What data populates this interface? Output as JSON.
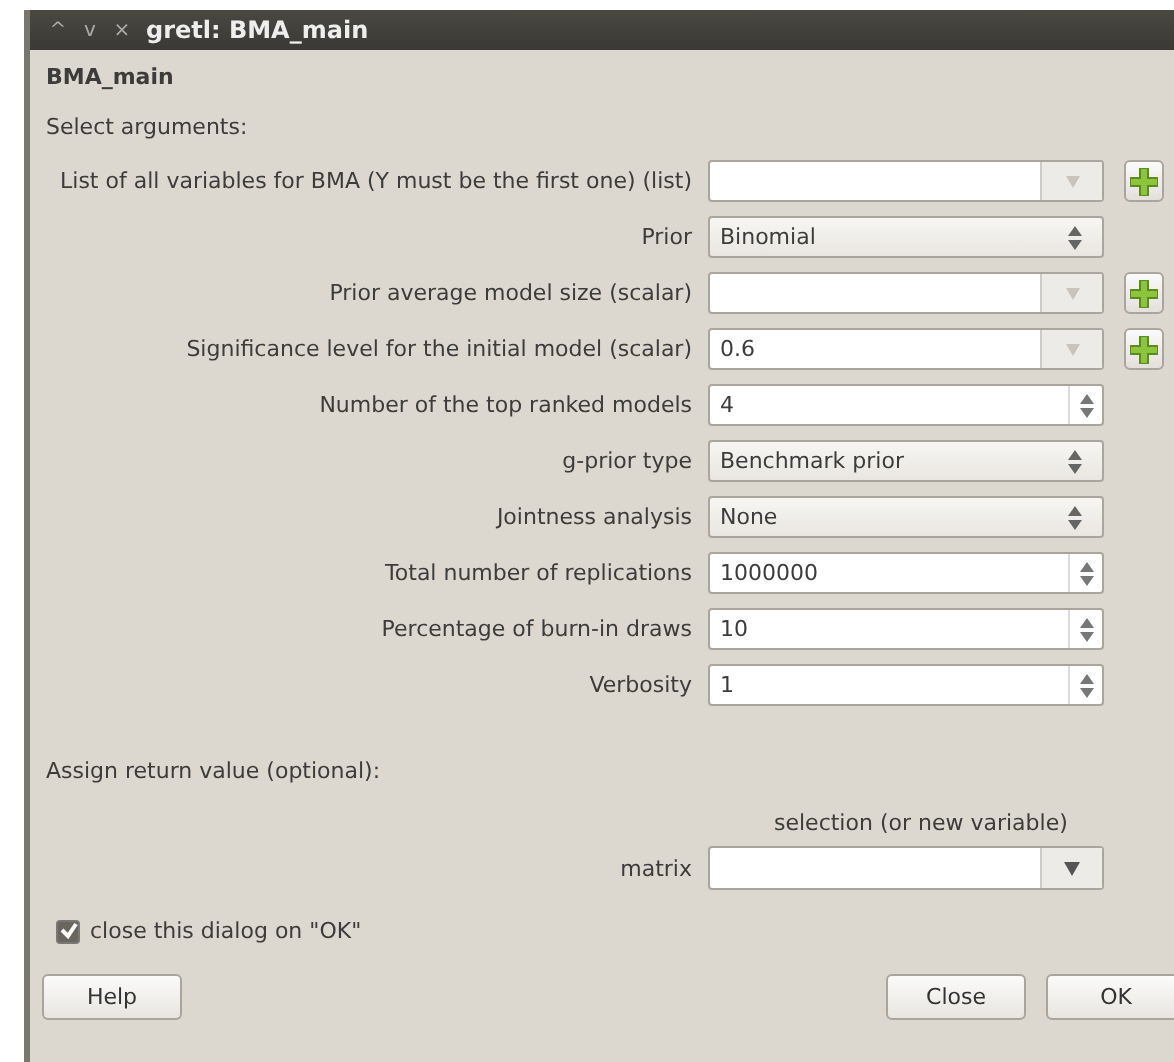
{
  "window": {
    "title": "gretl: BMA_main",
    "controls": [
      "^",
      "v",
      "×"
    ]
  },
  "heading": "BMA_main",
  "section_label": "Select arguments:",
  "arguments": [
    {
      "label": "List of all variables for BMA (Y must be the first one) (list)",
      "kind": "combo",
      "add_button": true
    },
    {
      "label": "Prior",
      "kind": "select",
      "value": "Binomial",
      "add_button": false
    },
    {
      "label": "Prior average model size (scalar)",
      "kind": "combo",
      "add_button": true
    },
    {
      "label": "Significance level for the initial model (scalar)",
      "kind": "combo",
      "value": "0.6",
      "add_button": true
    },
    {
      "label": "Number of the top ranked models",
      "kind": "spin",
      "value": "4",
      "add_button": false
    },
    {
      "label": "g-prior type",
      "kind": "select",
      "value": "Benchmark prior",
      "add_button": false
    },
    {
      "label": "Jointness analysis",
      "kind": "select",
      "value": "None",
      "add_button": false
    },
    {
      "label": "Total number of replications",
      "kind": "spin",
      "value": "1000000",
      "add_button": false
    },
    {
      "label": "Percentage of burn-in draws",
      "kind": "spin",
      "value": "10",
      "add_button": false
    },
    {
      "label": "Verbosity",
      "kind": "spin",
      "value": "1",
      "add_button": false
    }
  ],
  "return_section": {
    "label": "Assign return value (optional):",
    "column_heading": "selection (or new variable)",
    "type_label": "matrix"
  },
  "close_on_ok": {
    "label": "close this dialog on \"OK\"",
    "checked": true
  },
  "buttons": {
    "left": [
      "Help"
    ],
    "right": [
      "Close",
      "OK"
    ]
  }
}
